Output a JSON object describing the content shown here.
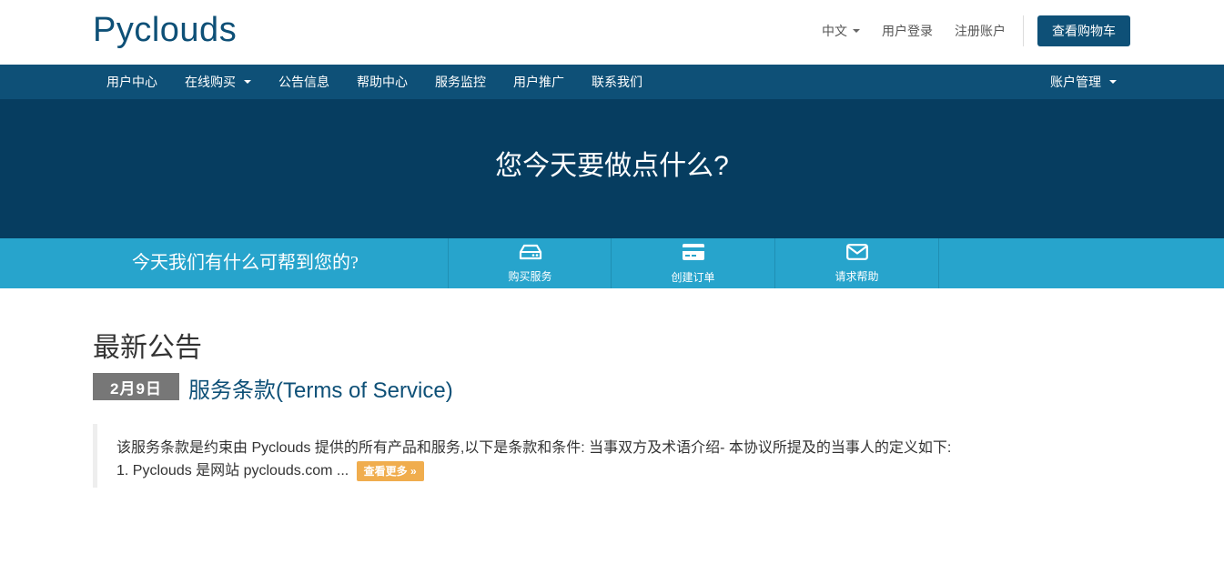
{
  "header": {
    "logo": "Pyclouds",
    "language": "中文",
    "login": "用户登录",
    "register": "注册账户",
    "cart": "查看购物车"
  },
  "nav": {
    "items": [
      {
        "label": "用户中心",
        "dropdown": false
      },
      {
        "label": "在线购买",
        "dropdown": true
      },
      {
        "label": "公告信息",
        "dropdown": false
      },
      {
        "label": "帮助中心",
        "dropdown": false
      },
      {
        "label": "服务监控",
        "dropdown": false
      },
      {
        "label": "用户推广",
        "dropdown": false
      },
      {
        "label": "联系我们",
        "dropdown": false
      }
    ],
    "account": "账户管理"
  },
  "hero": {
    "title": "您今天要做点什么?"
  },
  "actionbar": {
    "help_text": "今天我们有什么可帮到您的?",
    "actions": [
      {
        "icon": "server-icon",
        "label": "购买服务"
      },
      {
        "icon": "credit-card-icon",
        "label": "创建订单"
      },
      {
        "icon": "envelope-icon",
        "label": "请求帮助"
      }
    ]
  },
  "announcements": {
    "section_title": "最新公告",
    "post": {
      "date": "2月9日",
      "title": "服务条款(Terms of Service)",
      "excerpt_line1": "该服务条款是约束由 Pyclouds 提供的所有产品和服务,以下是条款和条件: 当事双方及术语介绍- 本协议所提及的当事人的定义如下:",
      "excerpt_line2": "1. Pyclouds 是网站 pyclouds.com ...",
      "more_label": "查看更多 »"
    }
  },
  "colors": {
    "brand": "#0e5077",
    "hero": "#063d60",
    "action_bar": "#27a4cc",
    "more_button": "#f0ad4e",
    "date_badge": "#777777"
  }
}
